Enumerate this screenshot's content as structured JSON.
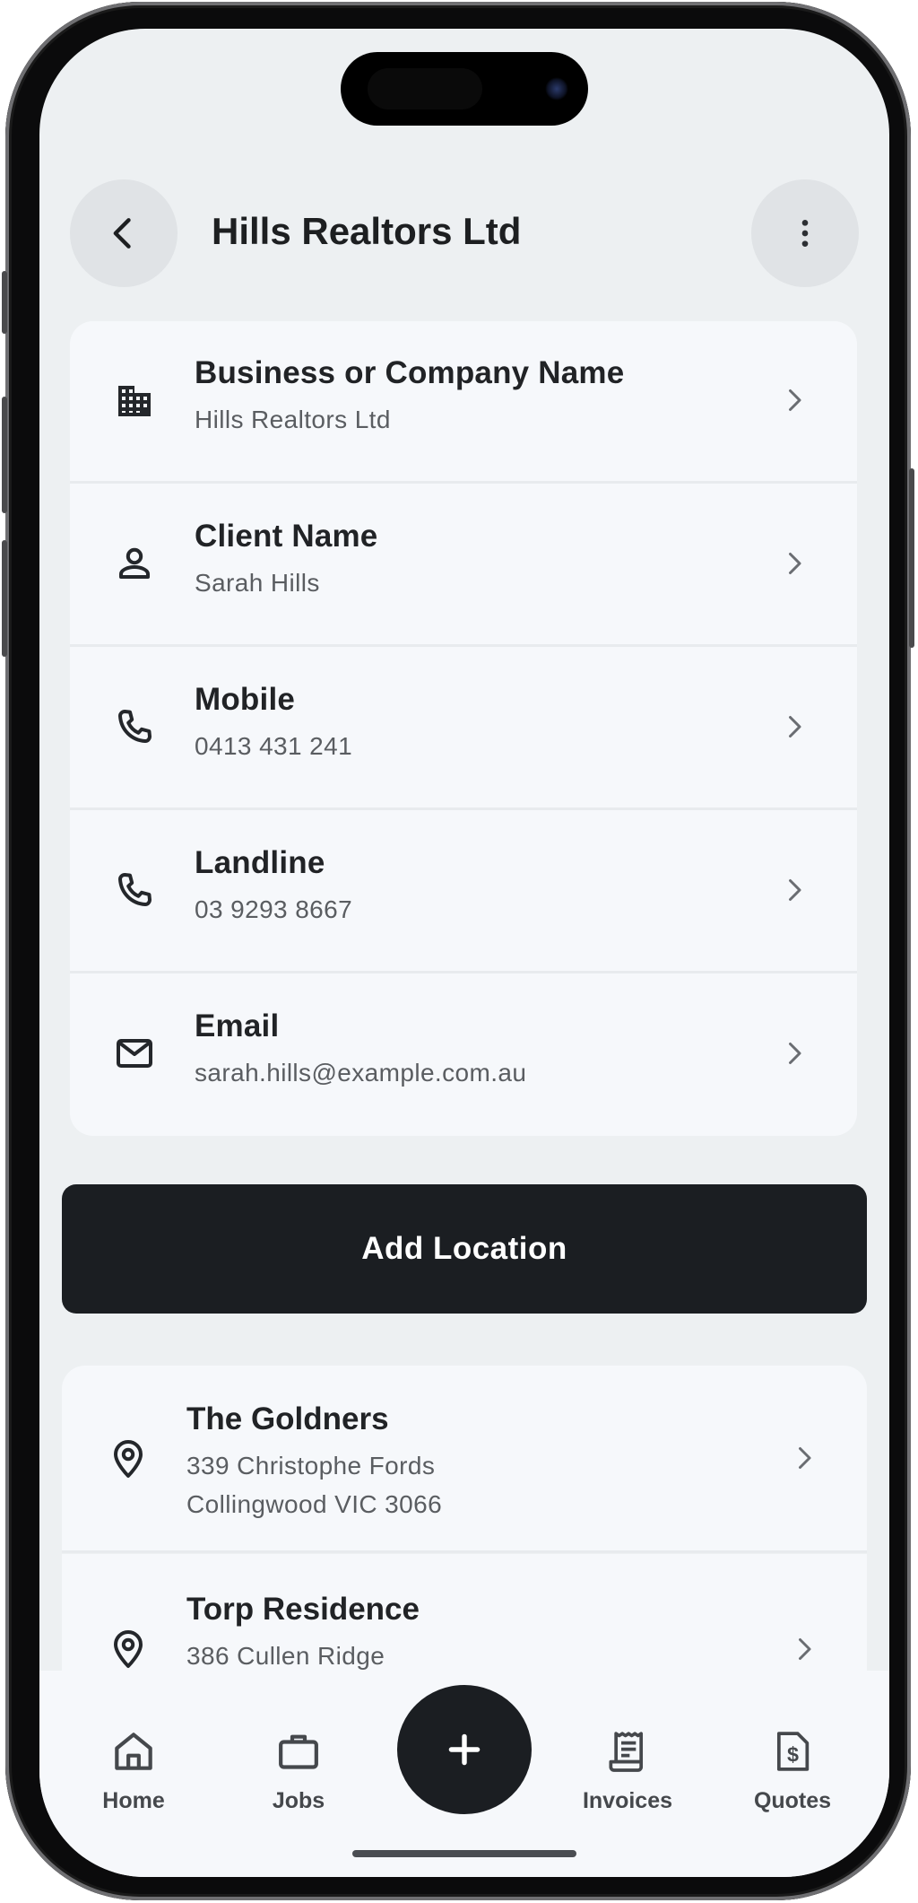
{
  "header": {
    "title": "Hills Realtors Ltd",
    "back_icon": "chevron-left-icon",
    "more_icon": "more-vertical-icon"
  },
  "details": [
    {
      "icon": "building-icon",
      "label": "Business or Company Name",
      "value": "Hills Realtors Ltd"
    },
    {
      "icon": "person-icon",
      "label": "Client Name",
      "value": "Sarah Hills"
    },
    {
      "icon": "phone-icon",
      "label": "Mobile",
      "value": "0413 431 241"
    },
    {
      "icon": "phone-icon",
      "label": "Landline",
      "value": "03 9293 8667"
    },
    {
      "icon": "mail-icon",
      "label": "Email",
      "value": "sarah.hills@example.com.au"
    }
  ],
  "add_location_label": "Add Location",
  "locations": [
    {
      "name": "The Goldners",
      "line1": "339 Christophe Fords",
      "line2": "Collingwood VIC 3066"
    },
    {
      "name": "Torp Residence",
      "line1": "386 Cullen Ridge"
    }
  ],
  "tabbar": {
    "items": [
      {
        "label": "Home",
        "icon": "home-icon"
      },
      {
        "label": "Jobs",
        "icon": "briefcase-icon"
      },
      {
        "label": "Invoices",
        "icon": "receipt-icon"
      },
      {
        "label": "Quotes",
        "icon": "quote-document-icon"
      }
    ],
    "fab_icon": "plus-icon"
  },
  "colors": {
    "background": "#edf0f2",
    "card": "#f6f8fb",
    "primary_button": "#1b1e22",
    "text_primary": "#212326",
    "text_secondary": "#5a5d61"
  }
}
